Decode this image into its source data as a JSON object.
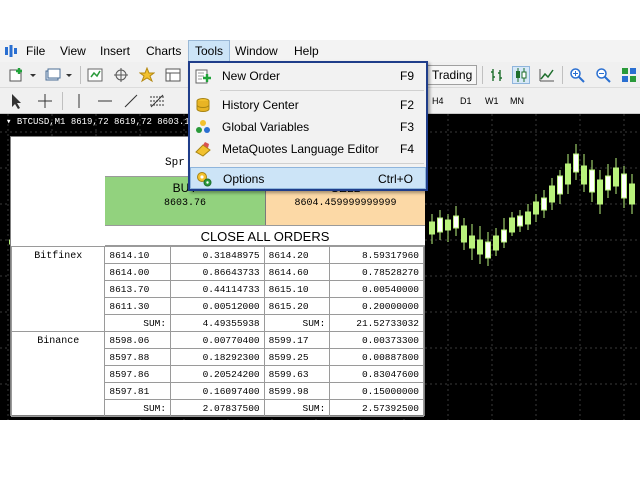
{
  "menubar": {
    "items": [
      "File",
      "View",
      "Insert",
      "Charts",
      "Tools",
      "Window",
      "Help"
    ],
    "active": "Tools"
  },
  "toolbar": {
    "algo_label": "Trading",
    "timeframes": [
      "H4",
      "D1",
      "W1",
      "MN"
    ]
  },
  "chart": {
    "header": "▾ BTCUSD,M1  8619,72 8619,72 8603.16 86",
    "background": "#000000",
    "bull_color": "#b9f27c",
    "bear_color": "#ffffff"
  },
  "tools_menu": {
    "items": [
      {
        "label": "New Order",
        "shortcut": "F9",
        "icon": "new-order-icon"
      },
      {
        "label": "History Center",
        "shortcut": "F2",
        "icon": "history-center-icon"
      },
      {
        "label": "Global Variables",
        "shortcut": "F3",
        "icon": "global-variables-icon"
      },
      {
        "label": "MetaQuotes Language Editor",
        "shortcut": "F4",
        "icon": "metaeditor-icon"
      },
      {
        "label": "Options",
        "shortcut": "Ctrl+O",
        "icon": "options-icon"
      }
    ],
    "highlighted": "Options"
  },
  "panel": {
    "spread_label": "Spr",
    "buy": {
      "label": "BUY",
      "price": "8603.76",
      "color": "#92d27e"
    },
    "sell": {
      "label": "SELL",
      "price": "8604.459999999999",
      "color": "#fcd9a6"
    },
    "close_all_label": "CLOSE ALL ORDERS",
    "exchanges": [
      {
        "name": "Bitfinex",
        "rows": [
          {
            "bid_price": "8614.10",
            "bid_vol": "0.31848975",
            "ask_price": "8614.20",
            "ask_vol": "8.59317960"
          },
          {
            "bid_price": "8614.00",
            "bid_vol": "0.86643733",
            "ask_price": "8614.60",
            "ask_vol": "0.78528270"
          },
          {
            "bid_price": "8613.70",
            "bid_vol": "0.44114733",
            "ask_price": "8615.10",
            "ask_vol": "0.00540000"
          },
          {
            "bid_price": "8611.30",
            "bid_vol": "0.00512000",
            "ask_price": "8615.20",
            "ask_vol": "0.20000000"
          }
        ],
        "sum_label": "SUM:",
        "bid_sum": "4.49355938",
        "ask_sum": "21.52733032"
      },
      {
        "name": "Binance",
        "rows": [
          {
            "bid_price": "8598.06",
            "bid_vol": "0.00770400",
            "ask_price": "8599.17",
            "ask_vol": "0.00373300"
          },
          {
            "bid_price": "8597.88",
            "bid_vol": "0.18292300",
            "ask_price": "8599.25",
            "ask_vol": "0.00887800"
          },
          {
            "bid_price": "8597.86",
            "bid_vol": "0.20524200",
            "ask_price": "8599.63",
            "ask_vol": "0.83047600"
          },
          {
            "bid_price": "8597.81",
            "bid_vol": "0.16097400",
            "ask_price": "8599.98",
            "ask_vol": "0.15000000"
          }
        ],
        "sum_label": "SUM:",
        "bid_sum": "2.07837500",
        "ask_sum": "2.57392500"
      }
    ]
  }
}
